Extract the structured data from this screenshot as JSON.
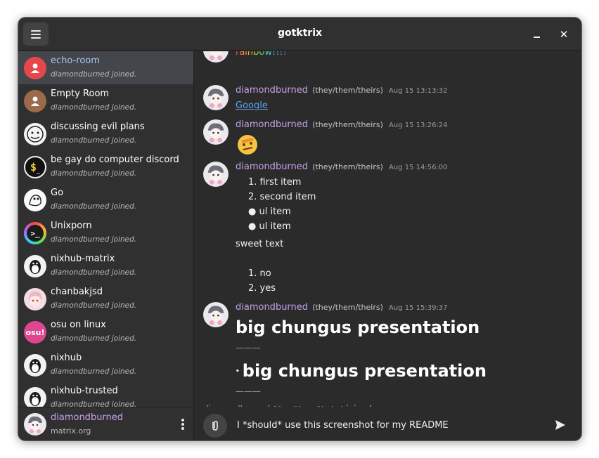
{
  "app": {
    "title": "gotktrix"
  },
  "icons": {
    "menu": "hamburger-menu-icon",
    "minimize": "minimize-icon",
    "close": "close-icon",
    "more": "vertical-dots-icon",
    "attach": "paperclip-icon",
    "send": "send-icon"
  },
  "colors": {
    "accent_purple": "#c7a0e8",
    "link_blue": "#5ea3f0",
    "selected_row": "#43474c"
  },
  "sidebar": {
    "rooms": [
      {
        "name": "echo-room",
        "subtitle": "diamondburned joined.",
        "avatar": "red-initial-icon",
        "selected": true
      },
      {
        "name": "Empty Room",
        "subtitle": "diamondburned joined.",
        "avatar": "brown-person-icon"
      },
      {
        "name": "discussing evil plans",
        "subtitle": "diamondburned joined.",
        "avatar": "doodle-avatar"
      },
      {
        "name": "be gay do computer discord",
        "subtitle": "diamondburned joined.",
        "avatar": "dollar-terminal-avatar"
      },
      {
        "name": "Go",
        "subtitle": "diamondburned joined.",
        "avatar": "gopher-avatar"
      },
      {
        "name": "Unixporn",
        "subtitle": "diamondburned joined.",
        "avatar": "terminal-rainbow-avatar"
      },
      {
        "name": "nixhub-matrix",
        "subtitle": "diamondburned joined.",
        "avatar": "tux-avatar"
      },
      {
        "name": "chanbakjsd",
        "subtitle": "diamondburned joined.",
        "avatar": "anime-avatar"
      },
      {
        "name": "osu on linux",
        "subtitle": "diamondburned joined.",
        "avatar": "osu-avatar",
        "avatar_text": "osu!"
      },
      {
        "name": "nixhub",
        "subtitle": "diamondburned joined.",
        "avatar": "tux-avatar"
      },
      {
        "name": "nixhub-trusted",
        "subtitle": "diamondburned joined.",
        "avatar": "tux-avatar"
      }
    ],
    "user": {
      "name": "diamondburned",
      "server": "matrix.org"
    }
  },
  "chat": {
    "partial_top_text": "rainbow!!!!",
    "messages": [
      {
        "sender": "diamondburned",
        "pronouns": "(they/them/theirs)",
        "time": "Aug 15 13:13:32",
        "link": "Google"
      },
      {
        "sender": "diamondburned",
        "pronouns": "(they/them/theirs)",
        "time": "Aug 15 13:26:24",
        "emoji": "thinking-emoji"
      },
      {
        "sender": "diamondburned",
        "pronouns": "(they/them/theirs)",
        "time": "Aug 15 14:56:00",
        "ol1": [
          "1. first item",
          "2. second item"
        ],
        "ul": [
          "ul item",
          "ul item"
        ],
        "text": "sweet text",
        "ol2": [
          "1. no",
          "2. yes"
        ]
      },
      {
        "sender": "diamondburned",
        "pronouns": "(they/them/theirs)",
        "time": "Aug 15 15:39:37",
        "heading1": "big chungus presentation",
        "rule1": "———",
        "heading2": "big chungus presentation",
        "rule2": "———"
      }
    ],
    "event": {
      "sender": "diamondburned",
      "pronouns": "(they/them/theirs)",
      "action": "joined."
    }
  },
  "composer": {
    "value": "I *should* use this screenshot for my README"
  }
}
